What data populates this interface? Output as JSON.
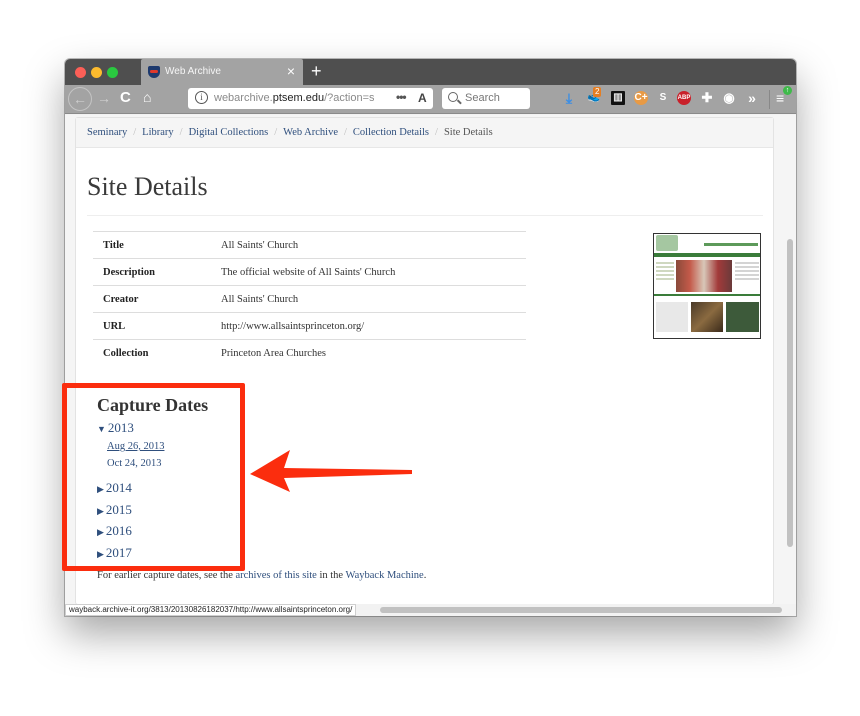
{
  "browser": {
    "tab_title": "Web Archive",
    "tab_close": "×",
    "new_tab": "+",
    "url_prefix": "webarchive.",
    "url_domain": "ptsem.edu",
    "url_suffix": "/?action=se",
    "url_more": "•••",
    "reader_icon": "A",
    "search_placeholder": "Search",
    "download_icon": "⤓",
    "ext_badge_count": "2",
    "ext_c_label": "C+",
    "ext_s_label": "S",
    "ext_abp_label": "ABP",
    "puzzle_icon": "✚",
    "account_icon": "◉",
    "overflow_icon": "»",
    "menu_icon": "≡",
    "update_icon": "↑",
    "back_icon": "←",
    "forward_icon": "→",
    "reload_icon": "C",
    "home_icon": "⌂",
    "info_icon": "i",
    "status_url": "wayback.archive-it.org/3813/20130826182037/http://www.allsaintsprinceton.org/"
  },
  "breadcrumb": [
    {
      "label": "Seminary"
    },
    {
      "label": "Library"
    },
    {
      "label": "Digital Collections"
    },
    {
      "label": "Web Archive"
    },
    {
      "label": "Collection Details"
    },
    {
      "label": "Site Details"
    }
  ],
  "page": {
    "title": "Site Details",
    "details": [
      {
        "key": "Title",
        "value": "All Saints' Church"
      },
      {
        "key": "Description",
        "value": "The official website of All Saints' Church"
      },
      {
        "key": "Creator",
        "value": "All Saints' Church"
      },
      {
        "key": "URL",
        "value": "http://www.allsaintsprinceton.org/"
      },
      {
        "key": "Collection",
        "value": "Princeton Area Churches"
      }
    ],
    "thumbnail_alt": "All Saints' Church website screenshot",
    "capture_title": "Capture Dates",
    "years": [
      {
        "label": "2013",
        "caret": "▼",
        "expanded": true,
        "dates": [
          "Aug 26, 2013",
          "Oct 24, 2013"
        ]
      },
      {
        "label": "2014",
        "caret": "▶",
        "expanded": false
      },
      {
        "label": "2015",
        "caret": "▶",
        "expanded": false
      },
      {
        "label": "2016",
        "caret": "▶",
        "expanded": false
      },
      {
        "label": "2017",
        "caret": "▶",
        "expanded": false
      }
    ],
    "footnote_before": "For earlier capture dates, see the ",
    "footnote_link1": "archives of this site",
    "footnote_middle": " in the ",
    "footnote_link2": "Wayback Machine",
    "footnote_after": "."
  },
  "annotation": {
    "color": "#fb2d0e"
  }
}
